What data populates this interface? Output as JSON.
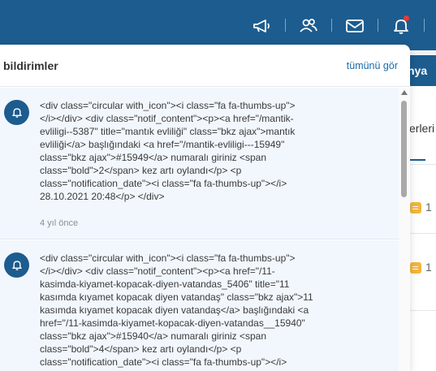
{
  "topbar": {
    "icons": [
      "megaphone-icon",
      "users-icon",
      "envelope-icon",
      "bell-icon"
    ],
    "bell_has_new": true
  },
  "background": {
    "tab_label": "nya",
    "section_label": "erleri",
    "badge_counts": [
      "1",
      "1"
    ]
  },
  "notifications": {
    "title": "bildirimler",
    "see_all": "tümünü gör",
    "items": [
      {
        "text": "<div class=\"circular with_icon\"><i class=\"fa fa-thumbs-up\">\n</i></div> <div class=\"notif_content\"><p><a href=\"/mantik-\nevliligi--5387\" title=\"mantık evliliği\" class=\"bkz ajax\">mantık\nevliliği</a> başlığındaki <a href=\"/mantik-evliligi---15949\"\nclass=\"bkz ajax\">#15949</a> numaralı giriniz <span\nclass=\"bold\">2</span> kez artı oylandı</p> <p\nclass=\"notification_date\"><i class=\"fa fa-thumbs-up\"></i>\n28.10.2021 20:48</p> </div>",
        "time": "4 yıl önce"
      },
      {
        "text": "<div class=\"circular with_icon\"><i class=\"fa fa-thumbs-up\">\n</i></div> <div class=\"notif_content\"><p><a href=\"/11-\nkasimda-kiyamet-kopacak-diyen-vatandas_5406\" title=\"11\nkasımda kıyamet kopacak diyen vatandaş\" class=\"bkz ajax\">11\nkasımda kıyamet kopacak diyen vatandaş</a> başlığındaki <a\nhref=\"/11-kasimda-kiyamet-kopacak-diyen-vatandas__15940\"\nclass=\"bkz ajax\">#15940</a> numaralı giriniz <span\nclass=\"bold\">4</span> kez artı oylandı</p> <p\nclass=\"notification_date\"><i class=\"fa fa-thumbs-up\"></i>",
        "time": ""
      }
    ]
  },
  "colors": {
    "brand": "#1c5c8f",
    "link": "#1c6aa8",
    "item_bg": "#f2f7fd",
    "alert_dot": "#e53935",
    "badge": "#f3b53c"
  }
}
